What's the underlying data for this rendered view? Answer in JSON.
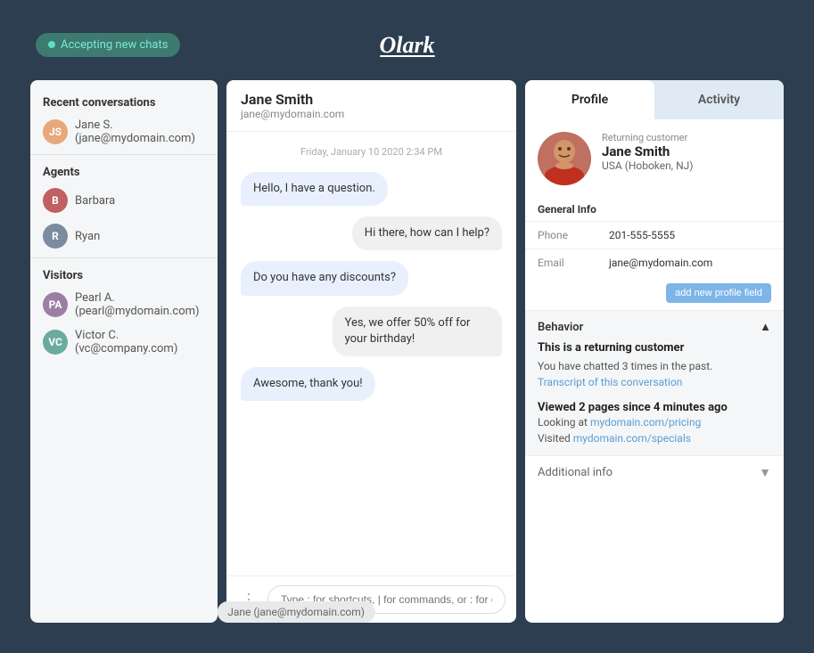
{
  "app": {
    "title": "Olark",
    "status": "Accepting new chats"
  },
  "sidebar": {
    "recent_label": "Recent conversations",
    "agents_label": "Agents",
    "visitors_label": "Visitors",
    "recent_items": [
      {
        "name": "Jane S. (jane@mydomain.com)",
        "initials": "JS"
      }
    ],
    "agents": [
      {
        "name": "Barbara",
        "initials": "B"
      },
      {
        "name": "Ryan",
        "initials": "R"
      }
    ],
    "visitors": [
      {
        "name": "Pearl A. (pearl@mydomain.com)",
        "initials": "PA"
      },
      {
        "name": "Victor C. (vc@company.com)",
        "initials": "VC"
      }
    ]
  },
  "chat": {
    "contact_name": "Jane Smith",
    "contact_email": "jane@mydomain.com",
    "date_divider": "Friday, January 10 2020 2:34 PM",
    "messages": [
      {
        "text": "Hello, I have a question.",
        "type": "visitor"
      },
      {
        "text": "Hi there, how can I help?",
        "type": "agent"
      },
      {
        "text": "Do you have any discounts?",
        "type": "visitor"
      },
      {
        "text": "Yes, we offer 50% off for your birthday!",
        "type": "agent"
      },
      {
        "text": "Awesome, thank you!",
        "type": "visitor"
      }
    ],
    "input_placeholder": "Type ; for shortcuts, | for commands, or : for emojis",
    "footer_tag": "Jane (jane@mydomain.com)"
  },
  "profile": {
    "tab_profile": "Profile",
    "tab_activity": "Activity",
    "returning_label": "Returning customer",
    "user_name": "Jane Smith",
    "user_location": "USA (Hoboken, NJ)",
    "general_info_label": "General Info",
    "phone_label": "Phone",
    "phone_value": "201-555-5555",
    "email_label": "Email",
    "email_value": "jane@mydomain.com",
    "add_field_btn": "add new profile field",
    "behavior_label": "Behavior",
    "behavior_returning_title": "This is a returning customer",
    "behavior_returning_text": "You have chatted 3 times in the past.",
    "behavior_transcript_text": "Transcript of this conversation",
    "behavior_viewed_title": "Viewed 2 pages since 4 minutes ago",
    "behavior_looking_prefix": "Looking at",
    "behavior_looking_link": "mydomain.com/pricing",
    "behavior_visited_prefix": "Visited",
    "behavior_visited_link": "mydomain.com/specials",
    "additional_info_label": "Additional info"
  }
}
